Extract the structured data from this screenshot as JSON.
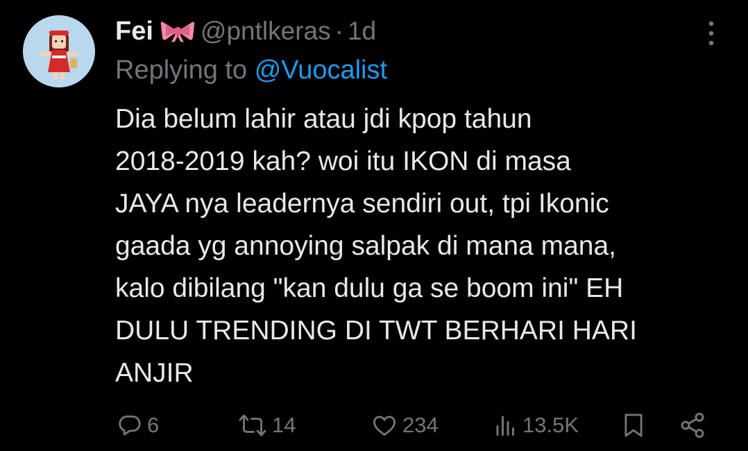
{
  "author": {
    "name": "Fei",
    "emoji": "🎀",
    "handle": "@pntlkeras",
    "separator": "·",
    "time": "1d"
  },
  "reply": {
    "prefix": "Replying to",
    "mention": "@Vuocalist"
  },
  "tweet": {
    "lines": [
      "Dia belum lahir atau jdi kpop tahun",
      "2018-2019 kah? woi itu IKON di masa",
      "JAYA nya leadernya sendiri out, tpi Ikonic",
      "gaada yg annoying salpak di mana mana,",
      "kalo dibilang \"kan dulu ga se boom ini\" EH",
      "DULU TRENDING DI TWT BERHARI HARI",
      "ANJIR"
    ]
  },
  "actions": {
    "replies": "6",
    "retweets": "14",
    "likes": "234",
    "views": "13.5K"
  },
  "icons": {
    "more": "more-vertical-icon",
    "reply": "reply-icon",
    "retweet": "retweet-icon",
    "like": "heart-icon",
    "views": "views-icon",
    "bookmark": "bookmark-icon",
    "share": "share-icon"
  },
  "colors": {
    "background": "#000000",
    "text": "#e7e9ea",
    "muted": "#71767b",
    "link": "#1d9bf0"
  }
}
